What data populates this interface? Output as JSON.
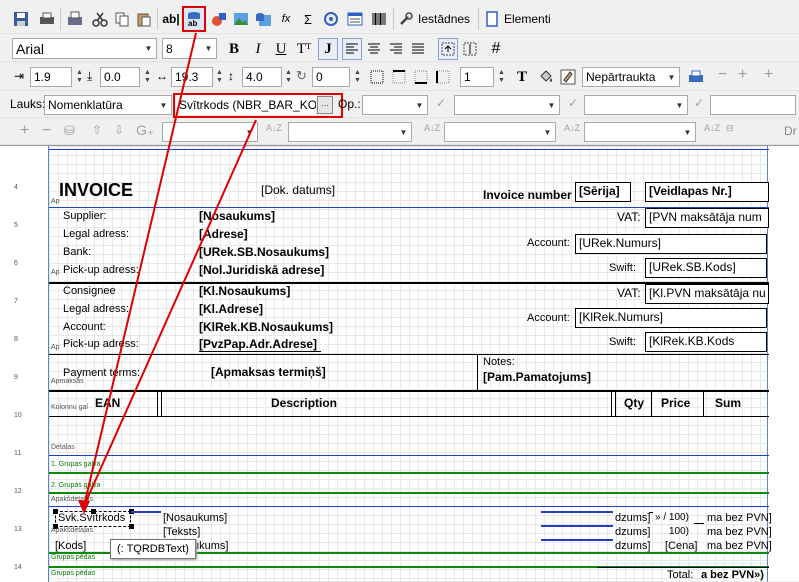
{
  "toolbar1": {
    "settings_label": "Iestādnes",
    "elements_label": "Elementi"
  },
  "toolbar2": {
    "font_name": "Arial",
    "font_size": "8"
  },
  "toolbar3": {
    "left_value": "1.9",
    "top_value": "0.0",
    "width_value": "19.3",
    "height_value": "4.0",
    "rotate_value": "0",
    "frame_width_value": "1",
    "align_mode": "Nepārtraukta"
  },
  "toolbar4": {
    "field_label": "Lauks:",
    "field_value": "Nomenklatūra",
    "barcode_value": "Svītrkods   (NBR_BAR_KODS",
    "ellipsis": "···",
    "op_label": "Op.:"
  },
  "toolbar5": {
    "dr_label": "Dr"
  },
  "ruler": [
    "4",
    "5",
    "6",
    "7",
    "8",
    "9",
    "10",
    "11",
    "12",
    "13",
    "14"
  ],
  "report": {
    "invoice_title": "INVOICE",
    "doc_date": "[Dok. datums]",
    "invoice_number_label": "Invoice number",
    "series": "[Sērija]",
    "form_number": "[Veidlapas Nr.]",
    "supplier_label": "Supplier:",
    "supplier_name": "[Nosaukums]",
    "vat_label": "VAT:",
    "vat_value": "[PVN maksātāja num",
    "legal_address_label": "Legal adress:",
    "supplier_address": "[Adrese]",
    "account_label": "Account:",
    "supplier_account": "[URek.Numurs]",
    "bank_label": "Bank:",
    "supplier_bank": "[URek.SB.Nosaukums]",
    "swift_label": "Swift:",
    "supplier_swift": "[URek.SB.Kods]",
    "pickup_label": "Pick-up adress:",
    "supplier_pickup": "[Nol.Juridiskā adrese]",
    "consignee_label": "Consignee",
    "consignee_name": "[Kl.Nosaukums]",
    "consignee_vat": "[Kl.PVN maksātāja nu",
    "consignee_legal_label": "Legal adress:",
    "consignee_address": "[Kl.Adrese]",
    "consignee_account_label": "Account:",
    "consignee_account": "[KlRek.Numurs]",
    "consignee_bank_label": "Account:",
    "consignee_bank": "[KlRek.KB.Nosaukums]",
    "consignee_swift_label": "Swift:",
    "consignee_swift": "[KlRek.KB.Kods",
    "consignee_pickup_label": "Pick-up adress:",
    "consignee_pickup": "[PvzPap.Adr.Adrese]",
    "payment_terms_label": "Payment terms:",
    "payment_terms": "[Apmaksas termiņš]",
    "notes_label": "Notes:",
    "notes_value": "[Pam.Pamatojums]",
    "col_ean": "EAN",
    "col_description": "Description",
    "col_qty": "Qty",
    "col_price": "Price",
    "col_sum": "Sum",
    "total_label": "Total:",
    "total_value": "a bez PVN»)"
  },
  "bands": {
    "virsraksts": "Ap",
    "apmaksas": "Apmaksas",
    "kolonnu": "Kolonnu gal",
    "detalas": "Detaļas",
    "grupas_galva1": "1. Grupas galva",
    "grupas_galva2": "2. Grupas galva",
    "apaksdetalas": "Apakšdetaļas",
    "apaksdetalas2": "Apakšdetaļas",
    "grupas_pedas": "Grupas pēdas",
    "grupas_pedas2": "Grupas pēdas"
  },
  "detail": {
    "barcode_field": "Svk.Svītrkods",
    "name_field": "[Nosaukums]",
    "text_field": "[Teksts]",
    "code_field": "[Kods]",
    "bank_name_partial": "ukums]",
    "dzums1": "dzums]",
    "dzums2": "dzums]",
    "dzums3": "dzums]",
    "price_expr1": "» / 100)",
    "price_expr2": "100)",
    "price_field": "[Cena]",
    "sum_expr1": "ma bez PVN]",
    "sum_expr2": "ma bez PVN]",
    "sum_expr3": "ma bez PVN]"
  },
  "tooltip": "(: TQRDBText)",
  "colors": {
    "highlight": "#e00000",
    "band_green": "#0a8a0a",
    "band_blue": "#2040c0"
  }
}
